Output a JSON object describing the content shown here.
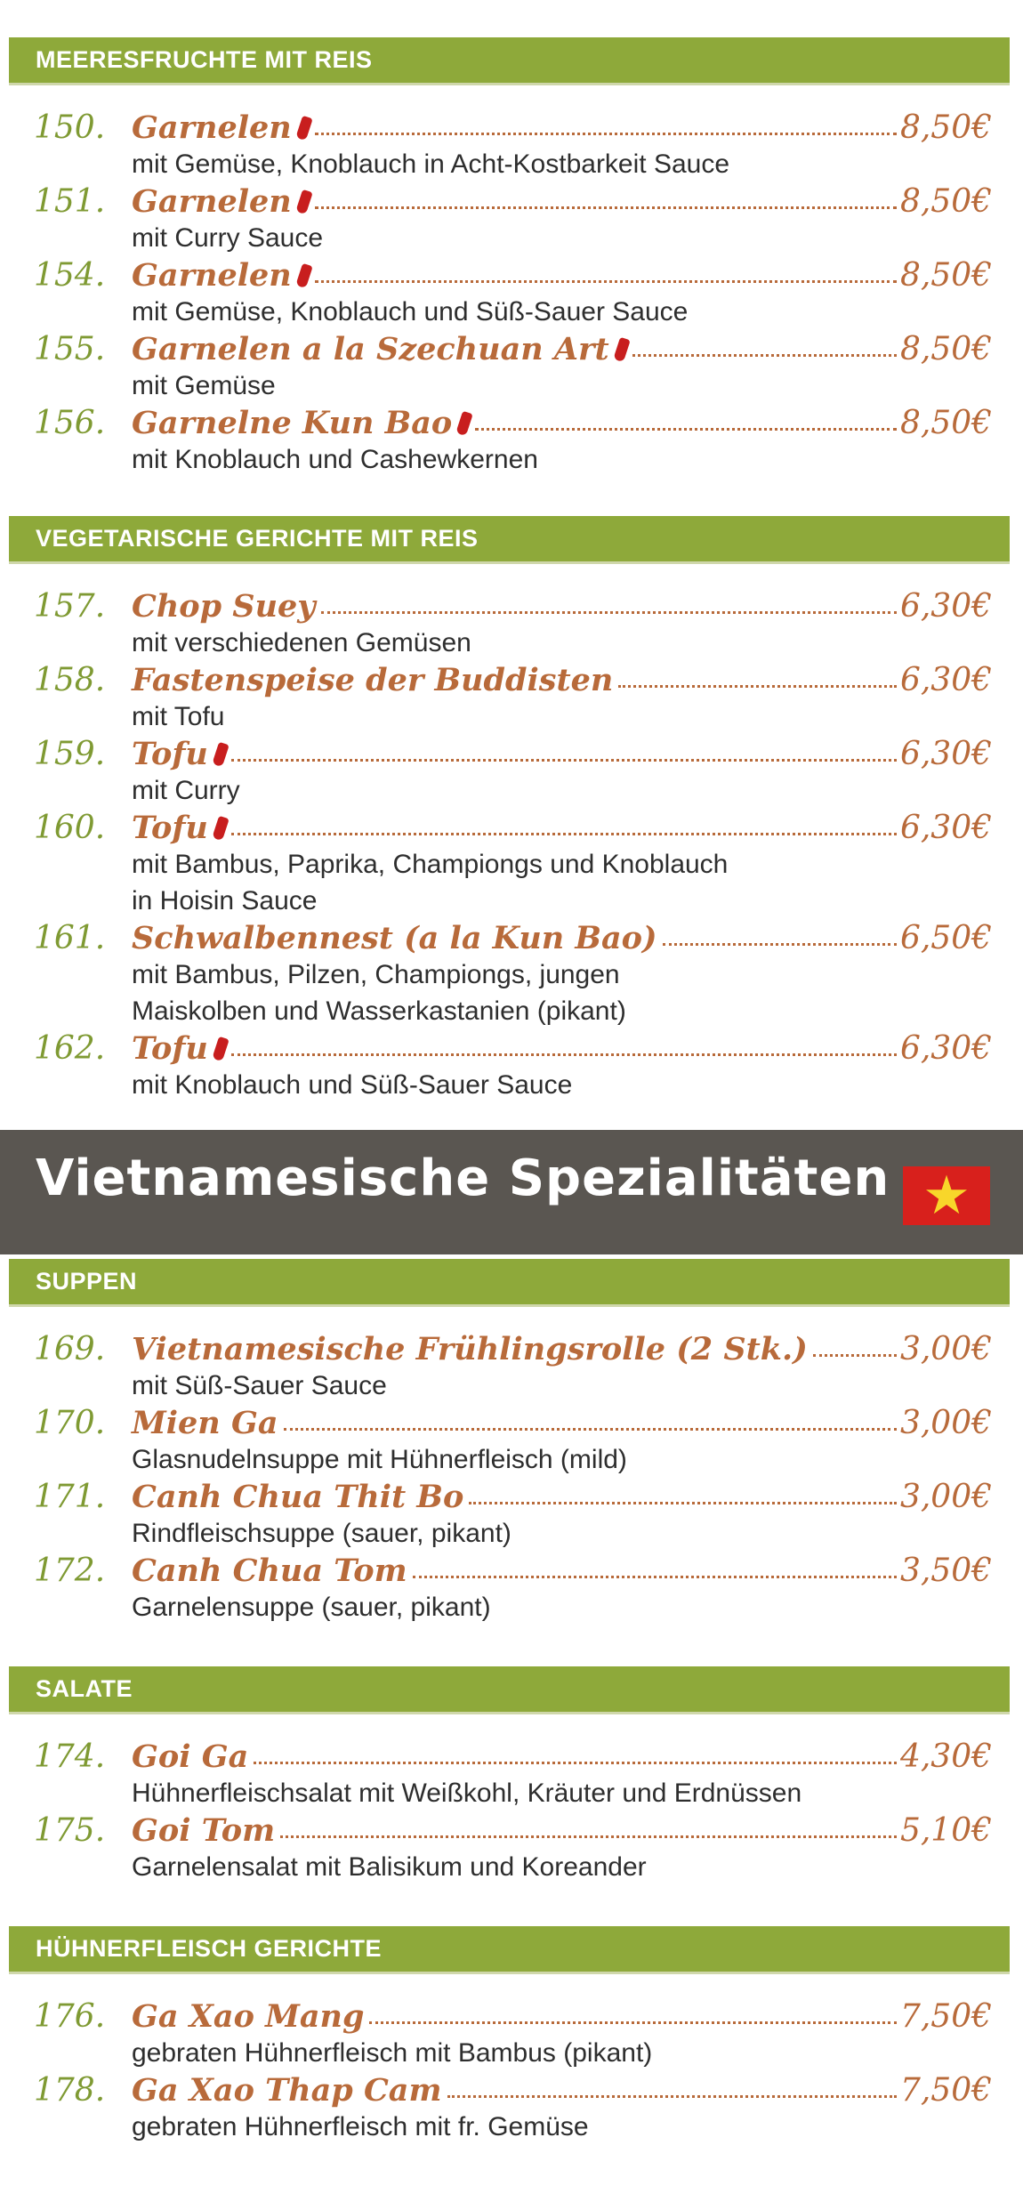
{
  "banner": {
    "title": "Vietnamesische Spezialitäten",
    "flag_icon": "star",
    "flag_colors": {
      "field": "#d8201c",
      "star": "#f8d62a"
    }
  },
  "colors": {
    "section_bar": "#8ea93a",
    "number": "#7f9a33",
    "dish": "#b86a3a",
    "banner": "#5a5651"
  },
  "sections": [
    {
      "title": "MEERESFRUCHTE MIT REIS",
      "items": [
        {
          "num": "150.",
          "name": "Garnelen",
          "spicy": true,
          "price": "8,50€",
          "desc": [
            "mit Gemüse, Knoblauch in Acht-Kostbarkeit Sauce"
          ]
        },
        {
          "num": "151.",
          "name": "Garnelen",
          "spicy": true,
          "price": "8,50€",
          "desc": [
            "mit Curry Sauce"
          ]
        },
        {
          "num": "154.",
          "name": "Garnelen",
          "spicy": true,
          "price": "8,50€",
          "desc": [
            "mit Gemüse, Knoblauch und Süß-Sauer Sauce"
          ]
        },
        {
          "num": "155.",
          "name": "Garnelen a la Szechuan Art",
          "spicy": true,
          "price": "8,50€",
          "desc": [
            "mit Gemüse"
          ]
        },
        {
          "num": "156.",
          "name": "Garnelne Kun Bao",
          "spicy": true,
          "price": "8,50€",
          "desc": [
            "mit Knoblauch und Cashewkernen"
          ]
        }
      ]
    },
    {
      "title": "VEGETARISCHE GERICHTE MIT REIS",
      "items": [
        {
          "num": "157.",
          "name": "Chop Suey",
          "spicy": false,
          "price": "6,30€",
          "desc": [
            "mit verschiedenen Gemüsen"
          ]
        },
        {
          "num": "158.",
          "name": "Fastenspeise der Buddisten",
          "spicy": false,
          "price": "6,30€",
          "desc": [
            "mit Tofu"
          ]
        },
        {
          "num": "159.",
          "name": "Tofu",
          "spicy": true,
          "price": "6,30€",
          "desc": [
            "mit Curry"
          ]
        },
        {
          "num": "160.",
          "name": "Tofu",
          "spicy": true,
          "price": "6,30€",
          "desc": [
            "mit Bambus, Paprika, Championgs und Knoblauch",
            "in Hoisin Sauce"
          ]
        },
        {
          "num": "161.",
          "name": "Schwalbennest (a la Kun Bao)",
          "spicy": false,
          "price": "6,50€",
          "desc": [
            "mit Bambus, Pilzen, Championgs, jungen",
            "Maiskolben und Wasserkastanien (pikant)"
          ]
        },
        {
          "num": "162.",
          "name": "Tofu",
          "spicy": true,
          "price": "6,30€",
          "desc": [
            "mit Knoblauch und Süß-Sauer Sauce"
          ]
        }
      ]
    },
    {
      "title": "SUPPEN",
      "items": [
        {
          "num": "169.",
          "name": "Vietnamesische Frühlingsrolle (2 Stk.)",
          "spicy": false,
          "price": "3,00€",
          "desc": [
            "mit Süß-Sauer Sauce"
          ]
        },
        {
          "num": "170.",
          "name": "Mien Ga",
          "spicy": false,
          "price": "3,00€",
          "desc": [
            "Glasnudelnsuppe mit Hühnerfleisch (mild)"
          ]
        },
        {
          "num": "171.",
          "name": "Canh Chua Thit Bo",
          "spicy": false,
          "price": "3,00€",
          "desc": [
            "Rindfleischsuppe (sauer, pikant)"
          ]
        },
        {
          "num": "172.",
          "name": "Canh Chua Tom",
          "spicy": false,
          "price": "3,50€",
          "desc": [
            "Garnelensuppe (sauer, pikant)"
          ]
        }
      ]
    },
    {
      "title": "SALATE",
      "items": [
        {
          "num": "174.",
          "name": "Goi Ga",
          "spicy": false,
          "price": "4,30€",
          "desc": [
            "Hühnerfleischsalat mit Weißkohl, Kräuter und Erdnüssen"
          ]
        },
        {
          "num": "175.",
          "name": "Goi Tom",
          "spicy": false,
          "price": "5,10€",
          "desc": [
            "Garnelensalat mit Balisikum und Koreander"
          ]
        }
      ]
    },
    {
      "title": "HÜHNERFLEISCH GERICHTE",
      "items": [
        {
          "num": "176.",
          "name": "Ga Xao Mang",
          "spicy": false,
          "price": "7,50€",
          "desc": [
            "gebraten Hühnerfleisch mit Bambus (pikant)"
          ]
        },
        {
          "num": "178.",
          "name": "Ga Xao Thap Cam",
          "spicy": false,
          "price": "7,50€",
          "desc": [
            "gebraten Hühnerfleisch mit fr. Gemüse"
          ]
        }
      ]
    }
  ]
}
